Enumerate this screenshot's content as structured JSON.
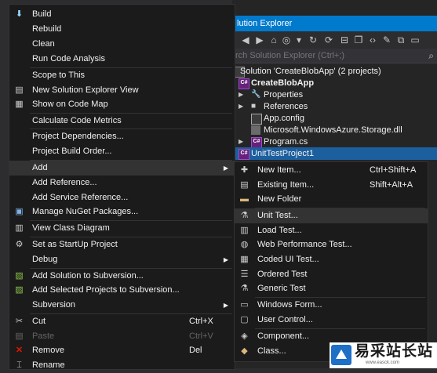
{
  "solution_explorer": {
    "title": "lution Explorer",
    "search_placeholder": "rch Solution Explorer (Ctrl+;)",
    "tree": [
      {
        "label": "Solution 'CreateBlobApp' (2 projects)",
        "icon": "solution-icon",
        "arrow": ""
      },
      {
        "label": "CreateBlobApp",
        "icon": "csharp-project-icon",
        "arrow": ""
      },
      {
        "label": "Properties",
        "icon": "wrench-icon",
        "arrow": "▶"
      },
      {
        "label": "References",
        "icon": "references-icon",
        "arrow": "▶"
      },
      {
        "label": "App.config",
        "icon": "config-file-icon",
        "arrow": ""
      },
      {
        "label": "Microsoft.WindowsAzure.Storage.dll",
        "icon": "dll-icon",
        "arrow": ""
      },
      {
        "label": "Program.cs",
        "icon": "csharp-file-icon",
        "arrow": "▶"
      },
      {
        "label": "UnitTestProject1",
        "icon": "csharp-project-icon",
        "arrow": ""
      }
    ]
  },
  "context_menu": {
    "items": [
      {
        "label": "Build",
        "icon": "build-icon"
      },
      {
        "label": "Rebuild"
      },
      {
        "label": "Clean"
      },
      {
        "label": "Run Code Analysis"
      },
      {
        "label": "Scope to This"
      },
      {
        "label": "New Solution Explorer View",
        "icon": "new-view-icon"
      },
      {
        "label": "Show on Code Map",
        "icon": "code-map-icon"
      },
      {
        "label": "Calculate Code Metrics"
      },
      {
        "label": "Project Dependencies..."
      },
      {
        "label": "Project Build Order..."
      },
      {
        "label": "Add",
        "submenu": true
      },
      {
        "label": "Add Reference..."
      },
      {
        "label": "Add Service Reference..."
      },
      {
        "label": "Manage NuGet Packages...",
        "icon": "nuget-icon"
      },
      {
        "label": "View Class Diagram",
        "icon": "class-diagram-icon"
      },
      {
        "label": "Set as StartUp Project",
        "icon": "gear-icon"
      },
      {
        "label": "Debug",
        "submenu": true
      },
      {
        "label": "Add Solution to Subversion...",
        "icon": "svn-add-icon"
      },
      {
        "label": "Add Selected Projects to Subversion...",
        "icon": "svn-add-icon"
      },
      {
        "label": "Subversion",
        "submenu": true
      },
      {
        "label": "Cut",
        "shortcut": "Ctrl+X",
        "icon": "scissors-icon"
      },
      {
        "label": "Paste",
        "shortcut": "Ctrl+V",
        "icon": "paste-icon",
        "disabled": true
      },
      {
        "label": "Remove",
        "shortcut": "Del",
        "icon": "remove-icon"
      },
      {
        "label": "Rename",
        "icon": "rename-icon"
      }
    ]
  },
  "add_submenu": {
    "items": [
      {
        "label": "New Item...",
        "shortcut": "Ctrl+Shift+A",
        "icon": "new-item-icon"
      },
      {
        "label": "Existing Item...",
        "shortcut": "Shift+Alt+A",
        "icon": "existing-item-icon"
      },
      {
        "label": "New Folder",
        "icon": "folder-icon"
      },
      {
        "label": "Unit Test...",
        "icon": "unit-test-icon"
      },
      {
        "label": "Load Test...",
        "icon": "load-test-icon"
      },
      {
        "label": "Web Performance Test...",
        "icon": "web-test-icon"
      },
      {
        "label": "Coded UI Test...",
        "icon": "coded-ui-icon"
      },
      {
        "label": "Ordered Test",
        "icon": "ordered-test-icon"
      },
      {
        "label": "Generic Test",
        "icon": "generic-test-icon"
      },
      {
        "label": "Windows Form...",
        "icon": "form-icon"
      },
      {
        "label": "User Control...",
        "icon": "user-control-icon"
      },
      {
        "label": "Component...",
        "icon": "component-icon"
      },
      {
        "label": "Class...",
        "icon": "class-icon"
      }
    ]
  },
  "watermark": {
    "text": "易采站长站",
    "sub": "www.easck.com"
  },
  "colors": {
    "accent": "#007acc",
    "menu_bg": "#1b1b1c",
    "highlight": "#333334",
    "selection": "#1c5f9e"
  }
}
